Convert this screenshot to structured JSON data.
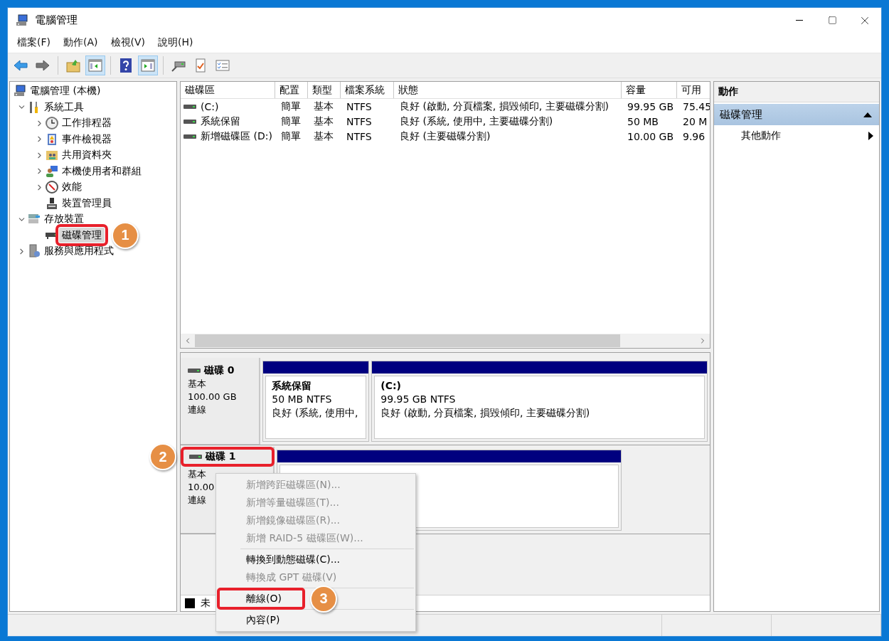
{
  "window": {
    "title": "電腦管理"
  },
  "menu": [
    "檔案(F)",
    "動作(A)",
    "檢視(V)",
    "說明(H)"
  ],
  "toolbar": [
    {
      "kind": "button",
      "pressed": false
    },
    {
      "kind": "button",
      "pressed": false
    },
    {
      "kind": "separator"
    },
    {
      "kind": "button",
      "pressed": false
    },
    {
      "kind": "button",
      "pressed": true
    },
    {
      "kind": "separator"
    },
    {
      "kind": "button",
      "pressed": false
    },
    {
      "kind": "button",
      "pressed": true
    },
    {
      "kind": "separator"
    },
    {
      "kind": "button",
      "pressed": false
    },
    {
      "kind": "button",
      "pressed": false
    },
    {
      "kind": "button",
      "pressed": false
    }
  ],
  "tree": [
    {
      "label": "電腦管理 (本機)",
      "kind": "plain",
      "selected": false,
      "children": [
        {
          "label": "系統工具",
          "kind": "expandable",
          "expanded": true,
          "selected": false,
          "children": [
            {
              "label": "工作排程器",
              "kind": "expandable",
              "expanded": false,
              "selected": false
            },
            {
              "label": "事件檢視器",
              "kind": "expandable",
              "expanded": false,
              "selected": false
            },
            {
              "label": "共用資料夾",
              "kind": "expandable",
              "expanded": false,
              "selected": false
            },
            {
              "label": "本機使用者和群組",
              "kind": "expandable",
              "expanded": false,
              "selected": false
            },
            {
              "label": "效能",
              "kind": "expandable",
              "expanded": false,
              "selected": false
            },
            {
              "label": "裝置管理員",
              "kind": "plain",
              "selected": false
            }
          ]
        },
        {
          "label": "存放裝置",
          "kind": "expandable",
          "expanded": true,
          "selected": false,
          "children": [
            {
              "label": "磁碟管理",
              "kind": "plain",
              "selected": true,
              "annotation": "1"
            }
          ]
        },
        {
          "label": "服務與應用程式",
          "kind": "expandable",
          "expanded": false,
          "selected": false
        }
      ]
    }
  ],
  "table": {
    "columns": [
      "磁碟區",
      "配置",
      "類型",
      "檔案系統",
      "狀態",
      "容量",
      "可用"
    ],
    "rows": [
      [
        "(C:)",
        "簡單",
        "基本",
        "NTFS",
        "良好 (啟動, 分頁檔案, 損毀傾印, 主要磁碟分割)",
        "99.95 GB",
        "75.45"
      ],
      [
        "系統保留",
        "簡單",
        "基本",
        "NTFS",
        "良好 (系統, 使用中, 主要磁碟分割)",
        "50 MB",
        "20 M"
      ],
      [
        "新增磁碟區 (D:)",
        "簡單",
        "基本",
        "NTFS",
        "良好 (主要磁碟分割)",
        "10.00 GB",
        "9.96"
      ]
    ]
  },
  "disks": [
    {
      "name": "磁碟 0",
      "type": "基本",
      "size": "100.00 GB",
      "status": "連線",
      "partitions": [
        {
          "kind": "primary",
          "name": "系統保留",
          "detail": "50 MB NTFS",
          "status": "良好 (系統, 使用中,"
        },
        {
          "kind": "primary",
          "name": "(C:)",
          "detail": "99.95 GB NTFS",
          "status": "良好 (啟動, 分頁檔案, 損毀傾印, 主要磁碟分割)"
        }
      ]
    },
    {
      "name": "磁碟 1",
      "type": "基本",
      "size": "10.00",
      "status": "連線",
      "annotation": "2",
      "partitions": [
        {
          "kind": "primary"
        }
      ]
    }
  ],
  "legend": [
    {
      "label": "未",
      "color": "#000000"
    }
  ],
  "context_menu": [
    {
      "kind": "item",
      "label": "新增跨距磁碟區(N)...",
      "disabled": true
    },
    {
      "kind": "item",
      "label": "新增等量磁碟區(T)...",
      "disabled": true
    },
    {
      "kind": "item",
      "label": "新增鏡像磁碟區(R)...",
      "disabled": true
    },
    {
      "kind": "item",
      "label": "新增 RAID-5 磁碟區(W)...",
      "disabled": true
    },
    {
      "kind": "separator"
    },
    {
      "kind": "item",
      "label": "轉換到動態磁碟(C)...",
      "disabled": false
    },
    {
      "kind": "item",
      "label": "轉換成 GPT 磁碟(V)",
      "disabled": true
    },
    {
      "kind": "separator"
    },
    {
      "kind": "item",
      "label": "離線(O)",
      "disabled": false,
      "annotation": "3"
    },
    {
      "kind": "separator"
    },
    {
      "kind": "item",
      "label": "內容(P)",
      "disabled": false
    }
  ],
  "actions": {
    "title": "動作",
    "sections": [
      {
        "label": "磁碟管理",
        "expanded": true,
        "items": [
          "其他動作"
        ]
      }
    ]
  }
}
